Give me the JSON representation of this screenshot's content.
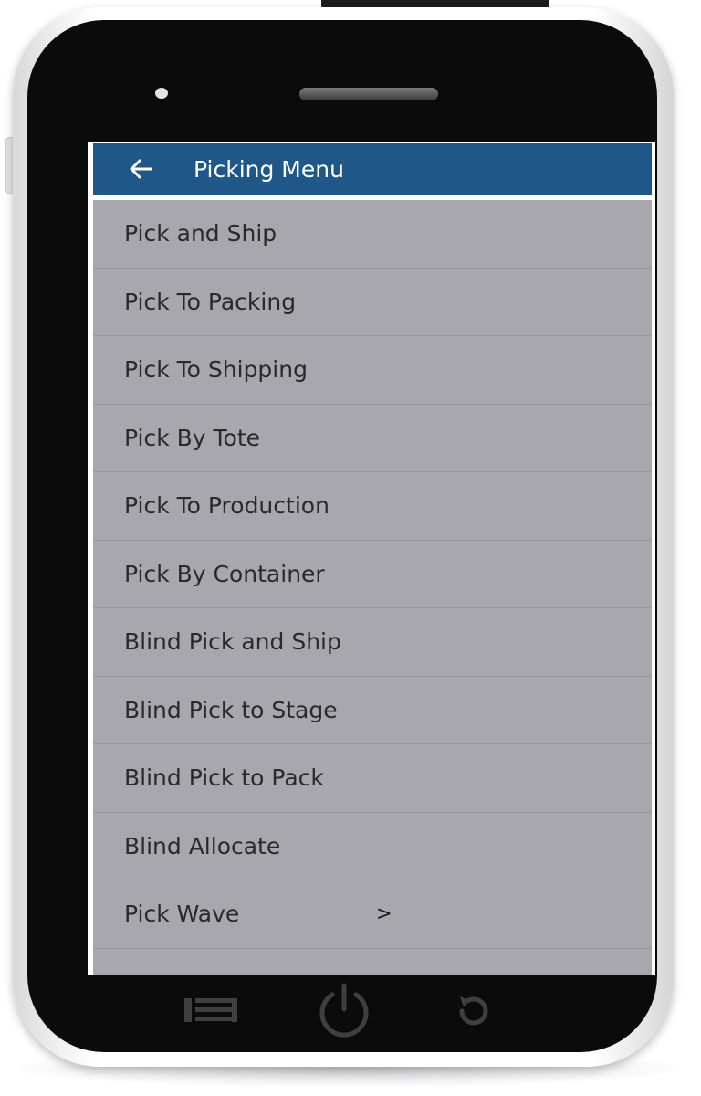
{
  "app_bar": {
    "back_icon": "arrow-left-icon",
    "title": "Picking Menu",
    "background_color": "#1f5789"
  },
  "menu": {
    "items": [
      {
        "label": "Pick and Ship"
      },
      {
        "label": "Pick To Packing"
      },
      {
        "label": "Pick To Shipping"
      },
      {
        "label": "Pick By Tote"
      },
      {
        "label": "Pick To Production"
      },
      {
        "label": "Pick By Container"
      },
      {
        "label": "Blind Pick and Ship"
      },
      {
        "label": "Blind Pick to Stage"
      },
      {
        "label": "Blind Pick to Pack"
      },
      {
        "label": "Blind Allocate"
      },
      {
        "label": "Pick Wave",
        "chevron": ">"
      }
    ]
  },
  "device_nav": {
    "left_icon": "menu-icon",
    "center_icon": "power-icon",
    "right_icon": "back-rotate-icon"
  }
}
